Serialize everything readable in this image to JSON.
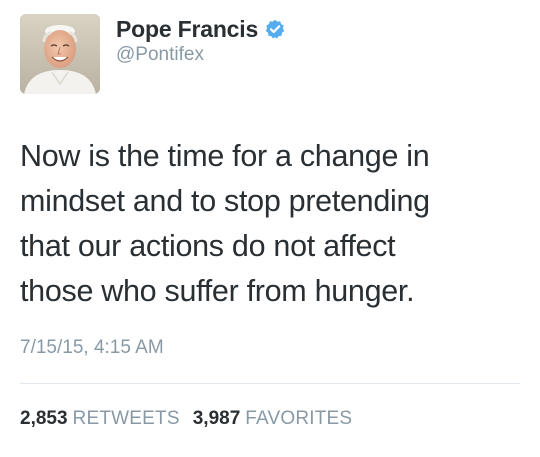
{
  "author": {
    "display_name": "Pope Francis",
    "handle": "@Pontifex",
    "verified": true,
    "verified_icon": "verified-badge-icon",
    "avatar": "profile-photo"
  },
  "tweet": {
    "lines": [
      "Now is the time for a change in",
      "mindset and to stop pretending",
      "that our actions do not affect",
      "those who suffer from hunger."
    ],
    "timestamp": "7/15/15, 4:15 AM"
  },
  "stats": {
    "retweets_count": "2,853",
    "retweets_label": "RETWEETS",
    "favorites_count": "3,987",
    "favorites_label": "FAVORITES"
  },
  "colors": {
    "text": "#292f33",
    "secondary": "#8899a6",
    "verified_blue": "#55acee",
    "divider": "#e1e8ed"
  }
}
